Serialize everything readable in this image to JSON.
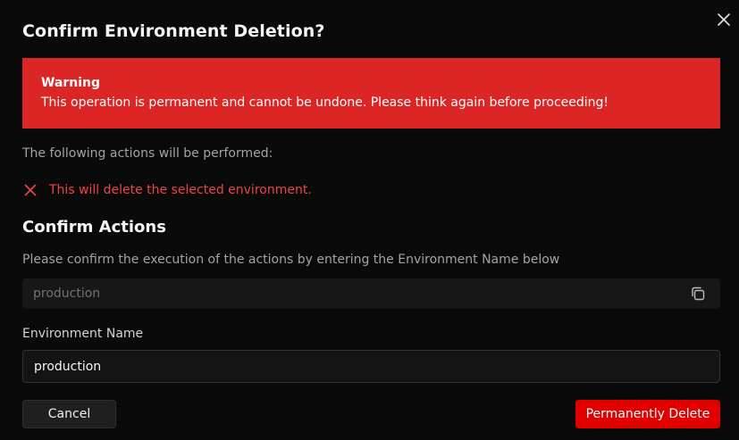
{
  "dialog": {
    "title": "Confirm Environment Deletion?",
    "close_icon": "close-icon"
  },
  "warning": {
    "title": "Warning",
    "message": "This operation is permanent and cannot be undone. Please think again before proceeding!",
    "color": "#dc2626"
  },
  "actions": {
    "intro": "The following actions will be performed:",
    "items": [
      {
        "icon": "x-icon",
        "text": "This will delete the selected environment."
      }
    ]
  },
  "confirm": {
    "title": "Confirm Actions",
    "help": "Please confirm the execution of the actions by entering the Environment Name below",
    "expected_value": "production",
    "copy_icon": "copy-icon"
  },
  "name_field": {
    "label": "Environment Name",
    "value": "production"
  },
  "buttons": {
    "cancel": "Cancel",
    "delete": "Permanently Delete",
    "delete_color": "#e00000"
  }
}
